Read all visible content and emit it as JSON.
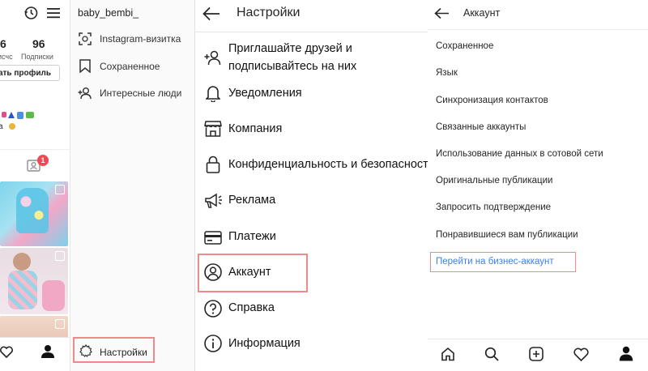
{
  "profile": {
    "username": "baby_bembi_",
    "stats": [
      {
        "value": "6",
        "label": "исчс"
      },
      {
        "value": "96",
        "label": "Подписки"
      }
    ],
    "edit_button": "ать профиль",
    "bio_line2": "а",
    "notification_count": "1"
  },
  "drawer": {
    "items": [
      {
        "label": "Instagram-визитка",
        "icon": "qr-scan-icon"
      },
      {
        "label": "Сохраненное",
        "icon": "bookmark-icon"
      },
      {
        "label": "Интересные люди",
        "icon": "add-person-icon"
      }
    ],
    "settings_label": "Настройки"
  },
  "settings": {
    "title": "Настройки",
    "items": [
      {
        "label": "Приглашайте друзей и подписывайтесь на них",
        "line1": "Приглашайте друзей и",
        "line2": "подписывайтесь на них",
        "icon": "add-person-icon"
      },
      {
        "label": "Уведомления",
        "icon": "bell-icon"
      },
      {
        "label": "Компания",
        "icon": "shop-icon"
      },
      {
        "label": "Конфиденциальность и безопасность",
        "display": "Конфиденциальность и безопасност",
        "icon": "lock-icon"
      },
      {
        "label": "Реклама",
        "icon": "megaphone-icon"
      },
      {
        "label": "Платежи",
        "icon": "card-icon"
      },
      {
        "label": "Аккаунт",
        "icon": "account-icon"
      },
      {
        "label": "Справка",
        "icon": "help-icon"
      },
      {
        "label": "Информация",
        "icon": "info-icon"
      }
    ]
  },
  "account": {
    "title": "Аккаунт",
    "items": [
      "Сохраненное",
      "Язык",
      "Синхронизация контактов",
      "Связанные аккаунты",
      "Использование данных в сотовой сети",
      "Оригинальные публикации",
      "Запросить подтверждение",
      "Понравившиеся вам публикации"
    ],
    "business_link": "Перейти на бизнес-аккаунт"
  },
  "bottom_nav": [
    "home-icon",
    "search-icon",
    "new-post-icon",
    "heart-icon",
    "profile-icon"
  ],
  "colors": {
    "highlight": "#f08a8a",
    "link": "#3d7fe0",
    "text": "#262626",
    "badge": "#ed4956"
  }
}
